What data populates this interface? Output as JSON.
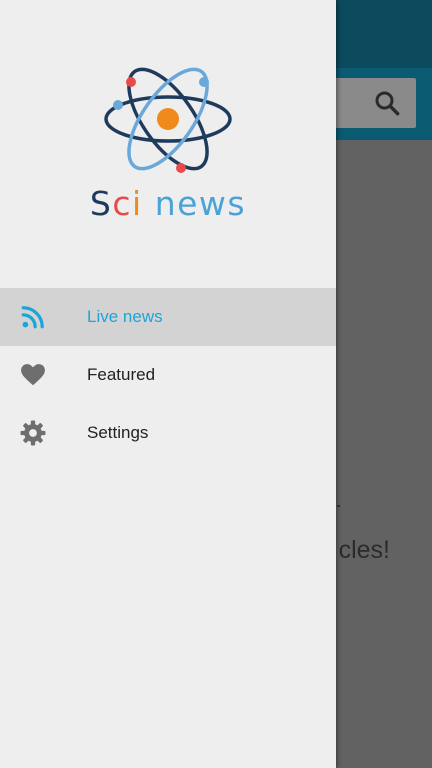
{
  "app": {
    "brand_letters": [
      "S",
      "c",
      "i",
      "news"
    ],
    "colors": {
      "brand_s": "#1e3a5c",
      "brand_c": "#e84a4a",
      "brand_i": "#f08a1a",
      "brand_news": "#4aa3d6",
      "accent": "#1aa6d9",
      "drawer_bg": "#eeeeee",
      "active_row_bg": "#d3d3d3",
      "appbar_bg": "#0c4a5e"
    }
  },
  "background": {
    "search_icon": "search-icon",
    "message_fragment": "cles!"
  },
  "drawer": {
    "logo_icon": "atom-logo-icon",
    "items": [
      {
        "label": "Live news",
        "icon": "rss-icon",
        "active": true
      },
      {
        "label": "Featured",
        "icon": "heart-icon",
        "active": false
      },
      {
        "label": "Settings",
        "icon": "gear-icon",
        "active": false
      }
    ]
  }
}
